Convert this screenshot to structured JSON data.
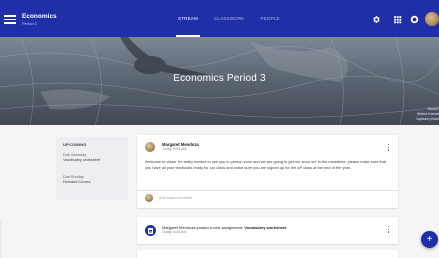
{
  "header": {
    "class_name": "Economics",
    "class_period": "Period 3",
    "tabs": [
      {
        "label": "STREAM",
        "active": true
      },
      {
        "label": "CLASSWORK",
        "active": false
      },
      {
        "label": "PEOPLE",
        "active": false
      }
    ],
    "icons": [
      "menu-icon",
      "gear-icon",
      "apps-icon",
      "account-icon"
    ],
    "accent_color": "#1f2fa8"
  },
  "hero": {
    "title": "Economics Period 3",
    "side_text": [
      "Stuck?",
      "Select theme",
      "Upload photo"
    ]
  },
  "upcoming": {
    "title": "UPCOMING",
    "items": [
      {
        "date": "Due Saturday",
        "name": "Vocabulary worksheet"
      },
      {
        "date": "Due Sunday",
        "name": "Demand Curves"
      }
    ]
  },
  "stream": {
    "posts": [
      {
        "author": "Margaret Mendoza",
        "time": "Today, 8:45 AM",
        "body": "Welcome to class! I'm really excited to see you in person soon and we are going to get our soon on! In the meantime, please make sure that you have all your textbooks ready for our class and make sure you are signed up for the AP class at the end of the year.",
        "comment_placeholder": "Add class comment"
      }
    ],
    "assignment": {
      "text_prefix": "Margaret Mendoza posted a new assignment:",
      "title": "Vocabulary worksheet",
      "time": "Today, 8:45 AM"
    }
  },
  "fab": {
    "label": "+"
  }
}
